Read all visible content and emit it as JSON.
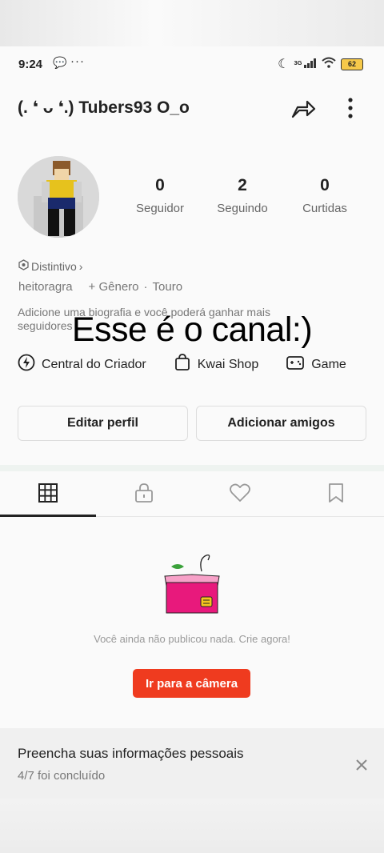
{
  "status_bar": {
    "time": "9:24",
    "more": "···",
    "network": "3G",
    "battery": "62"
  },
  "header": {
    "username": "(. ❛ ᴗ ❛.) Tubers93 O_o"
  },
  "stats": [
    {
      "value": "0",
      "label": "Seguidor"
    },
    {
      "value": "2",
      "label": "Seguindo"
    },
    {
      "value": "0",
      "label": "Curtidas"
    }
  ],
  "profile": {
    "badge_label": "Distintivo",
    "handle": "heitoragra",
    "gender": "+ Gênero",
    "separator": "·",
    "sign": "Touro",
    "bio_line1": "Adicione uma biografia e você poderá ganhar mais",
    "bio_line2": "seguidores"
  },
  "overlay_caption": "Esse é o canal:)",
  "links": [
    {
      "label": "Central do Criador",
      "icon": "creator-center-icon"
    },
    {
      "label": "Kwai Shop",
      "icon": "shopping-bag-icon"
    },
    {
      "label": "Game",
      "icon": "gamepad-icon"
    }
  ],
  "actions": {
    "edit": "Editar perfil",
    "add_friends": "Adicionar amigos"
  },
  "tabs": [
    {
      "name": "posts",
      "icon": "grid-icon",
      "active": true
    },
    {
      "name": "private",
      "icon": "lock-icon",
      "active": false
    },
    {
      "name": "likes",
      "icon": "heart-icon",
      "active": false
    },
    {
      "name": "saved",
      "icon": "bookmark-icon",
      "active": false
    }
  ],
  "empty_state": {
    "message": "Você ainda não publicou nada. Crie agora!",
    "cta": "Ir para a câmera"
  },
  "info_card": {
    "title": "Preencha suas informações pessoais",
    "progress": "4/7 foi concluído"
  },
  "colors": {
    "accent": "#ef3b1f",
    "box_pink": "#e8197c",
    "box_yellow": "#f5c51e"
  }
}
